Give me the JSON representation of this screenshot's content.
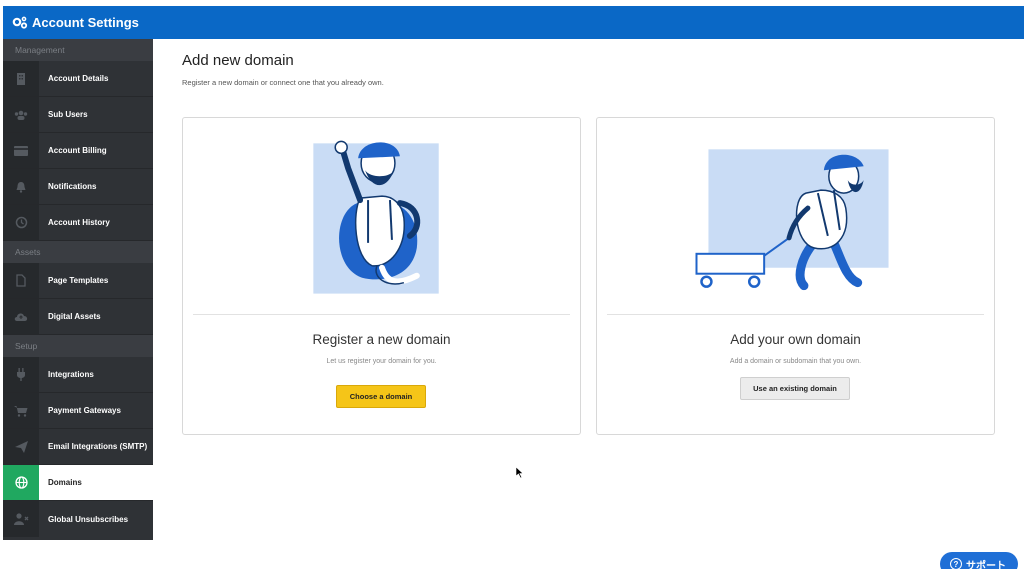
{
  "header": {
    "title": "Account Settings",
    "icon": "gears-icon",
    "color": "#0a68c6"
  },
  "sidebar": {
    "sections": [
      {
        "label": "Management"
      },
      {
        "label": "Assets"
      },
      {
        "label": "Setup"
      }
    ],
    "items": [
      {
        "label": "Account Details",
        "icon": "building-icon"
      },
      {
        "label": "Sub Users",
        "icon": "users-icon"
      },
      {
        "label": "Account Billing",
        "icon": "credit-card-icon"
      },
      {
        "label": "Notifications",
        "icon": "bell-icon"
      },
      {
        "label": "Account History",
        "icon": "history-icon"
      },
      {
        "label": "Page Templates",
        "icon": "file-icon"
      },
      {
        "label": "Digital Assets",
        "icon": "cloud-upload-icon"
      },
      {
        "label": "Integrations",
        "icon": "plug-icon"
      },
      {
        "label": "Payment Gateways",
        "icon": "cart-icon"
      },
      {
        "label": "Email Integrations (SMTP)",
        "icon": "paper-plane-icon"
      },
      {
        "label": "Domains",
        "icon": "globe-icon",
        "active": true,
        "active_color": "#20a860"
      },
      {
        "label": "Global Unsubscribes",
        "icon": "user-remove-icon"
      }
    ]
  },
  "main": {
    "title": "Add new domain",
    "subtitle": "Register a new domain or connect one that you already own.",
    "cards": [
      {
        "title": "Register a new domain",
        "description": "Let us register your domain for you.",
        "button": "Choose a domain"
      },
      {
        "title": "Add your own domain",
        "description": "Add a domain or subdomain that you own.",
        "button": "Use an existing domain"
      }
    ]
  },
  "support_button": {
    "label": "サポート",
    "icon": "question-icon"
  }
}
